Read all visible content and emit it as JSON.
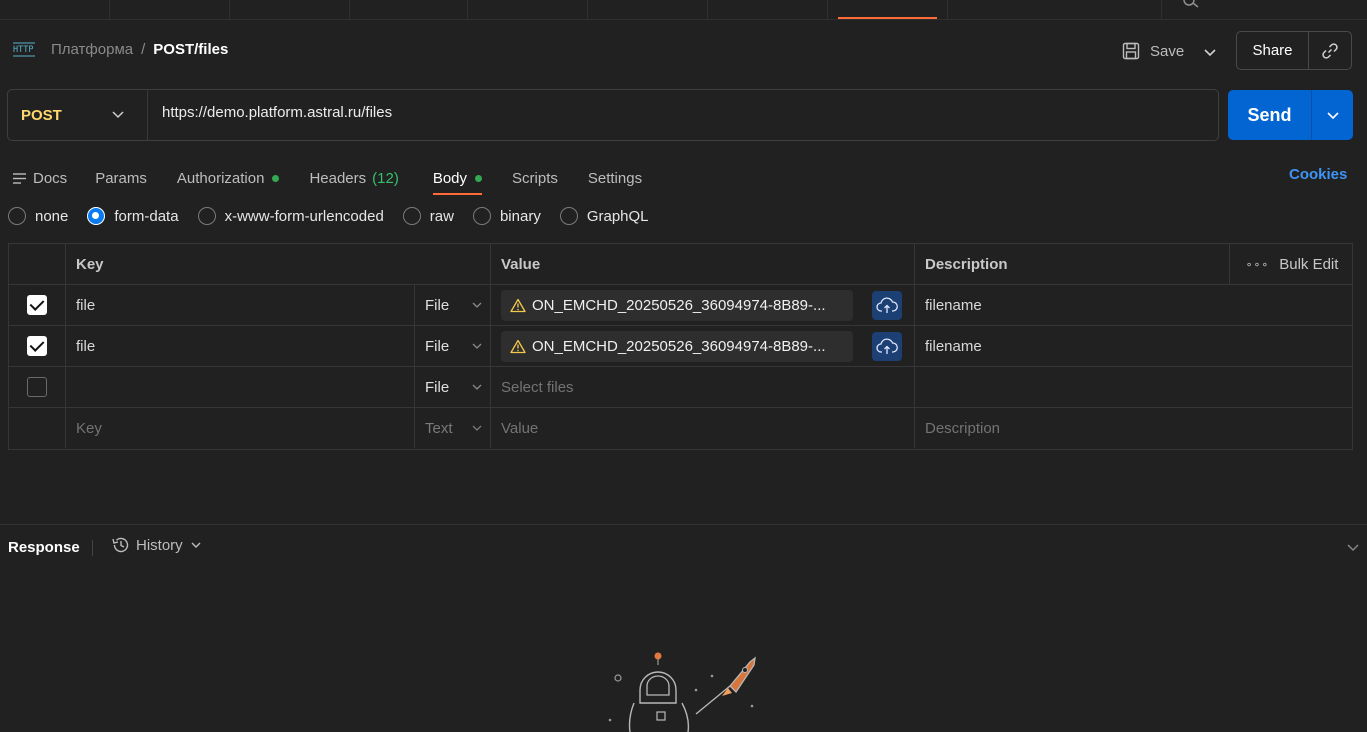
{
  "header": {
    "breadcrumb_root": "Платформа",
    "breadcrumb_sep": "/",
    "request_name": "POST/files",
    "save_label": "Save",
    "share_label": "Share"
  },
  "request": {
    "method": "POST",
    "url": "https://demo.platform.astral.ru/files",
    "send_label": "Send"
  },
  "tabs": [
    {
      "label": "Docs"
    },
    {
      "label": "Params"
    },
    {
      "label": "Authorization",
      "dot": true
    },
    {
      "label": "Headers",
      "count": "(12)"
    },
    {
      "label": "Body",
      "dot": true,
      "active": true
    },
    {
      "label": "Scripts"
    },
    {
      "label": "Settings"
    }
  ],
  "cookies_label": "Cookies",
  "body_types": [
    {
      "label": "none",
      "checked": false
    },
    {
      "label": "form-data",
      "checked": true
    },
    {
      "label": "x-www-form-urlencoded",
      "checked": false
    },
    {
      "label": "raw",
      "checked": false
    },
    {
      "label": "binary",
      "checked": false
    },
    {
      "label": "GraphQL",
      "checked": false
    }
  ],
  "table": {
    "headers": {
      "key": "Key",
      "value": "Value",
      "description": "Description",
      "bulk_edit": "Bulk Edit"
    },
    "rows": [
      {
        "checked": true,
        "key": "file",
        "type": "File",
        "value": "ON_EMCHD_20250526_36094974-8B89-...",
        "description": "filename"
      },
      {
        "checked": true,
        "key": "file",
        "type": "File",
        "value": "ON_EMCHD_20250526_36094974-8B89-...",
        "description": "filename"
      },
      {
        "checked": false,
        "key": "",
        "type": "File",
        "value_placeholder": "Select files",
        "description": ""
      }
    ],
    "new_row": {
      "key_placeholder": "Key",
      "type": "Text",
      "value_placeholder": "Value",
      "description_placeholder": "Description"
    }
  },
  "response": {
    "label": "Response",
    "history_label": "History"
  },
  "colors": {
    "background": "#212121",
    "accent_orange": "#ff6c37",
    "send_blue": "#0265d2",
    "method_yellow": "#ffd86b",
    "dot_green": "#34a853",
    "cookies_blue": "#3d94f6"
  }
}
